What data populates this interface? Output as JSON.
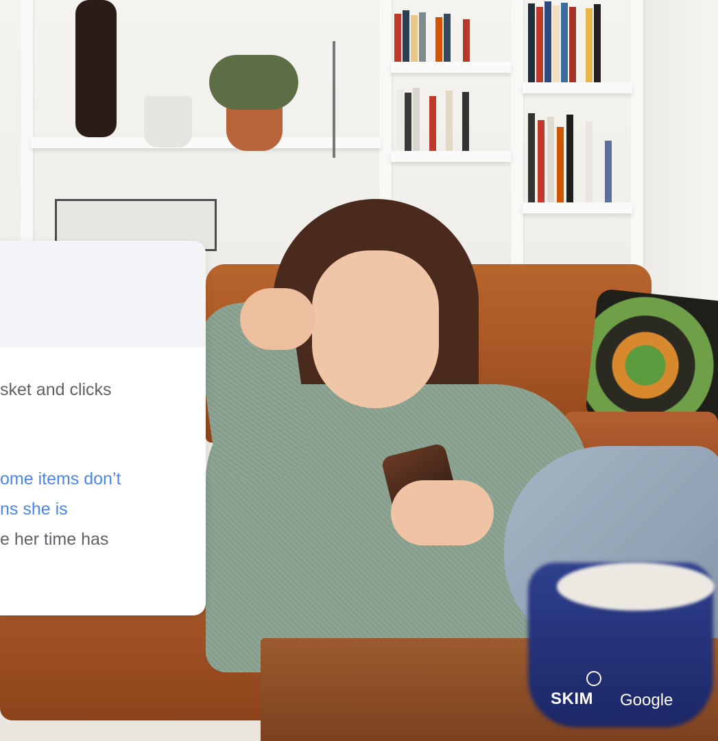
{
  "card": {
    "line1": "sket and clicks",
    "line2": "ome items don’t",
    "line3": "ns she is",
    "line4": "e her time has"
  },
  "logos": {
    "skim": "SKIM",
    "google": "Google"
  },
  "colors": {
    "accent_blue": "#4a86ec",
    "body_gray": "#5f6368",
    "header_bg": "#f3f5f8"
  }
}
